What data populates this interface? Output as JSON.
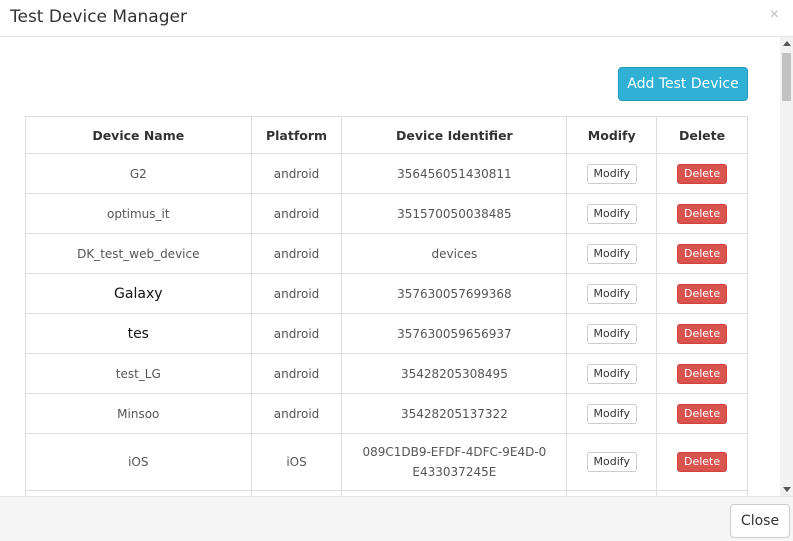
{
  "modal": {
    "title": "Test Device Manager",
    "close_icon": "×",
    "add_button": "Add Test Device",
    "footer_close": "Close"
  },
  "table": {
    "headers": [
      "Device Name",
      "Platform",
      "Device Identifier",
      "Modify",
      "Delete"
    ],
    "rows": [
      {
        "name": "G2",
        "platform": "android",
        "identifier": "356456051430811",
        "modify": "Modify",
        "delete": "Delete"
      },
      {
        "name": "optimus_it",
        "platform": "android",
        "identifier": "351570050038485",
        "modify": "Modify",
        "delete": "Delete"
      },
      {
        "name": "DK_test_web_device",
        "platform": "android",
        "identifier": "devices",
        "modify": "Modify",
        "delete": "Delete"
      },
      {
        "name": "Galaxy",
        "platform": "android",
        "identifier": "357630057699368",
        "modify": "Modify",
        "delete": "Delete"
      },
      {
        "name": "tes",
        "platform": "android",
        "identifier": "357630059656937",
        "modify": "Modify",
        "delete": "Delete"
      },
      {
        "name": "test_LG",
        "platform": "android",
        "identifier": "35428205308495",
        "modify": "Modify",
        "delete": "Delete"
      },
      {
        "name": "Minsoo",
        "platform": "android",
        "identifier": "35428205137322",
        "modify": "Modify",
        "delete": "Delete"
      },
      {
        "name": "iOS",
        "platform": "iOS",
        "identifier": "089C1DB9-EFDF-4DFC-9E4D-0E433037245E",
        "modify": "Modify",
        "delete": "Delete"
      }
    ]
  },
  "colors": {
    "primary": "#31b0d5",
    "danger": "#d9534f"
  }
}
